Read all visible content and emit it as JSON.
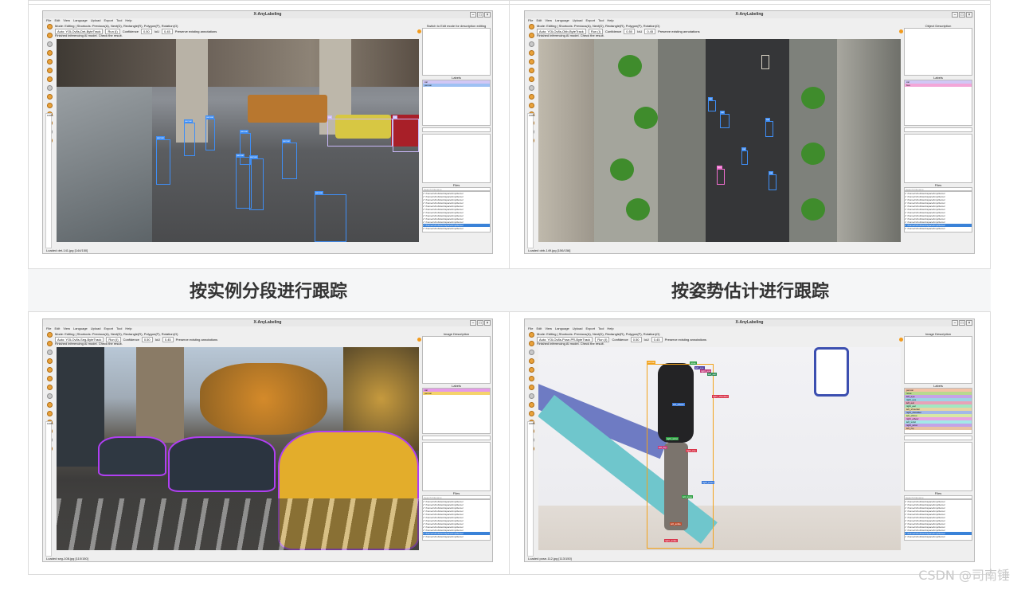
{
  "captions": {
    "segmentation": "按实例分段进行跟踪",
    "pose": "按姿势估计进行跟踪"
  },
  "watermark": "CSDN @司南锤",
  "app": {
    "window_title": "X-AnyLabeling",
    "menu": [
      "File",
      "Edit",
      "View",
      "Language",
      "Upload",
      "Export",
      "Tool",
      "Help"
    ],
    "mode_text": "Mode: Editing | Shortcuts: Previous(A), Next(D), Rectangle(R), Polygon(P), Rotation(O)",
    "status_msg": "Finished inferencing AI model. Check the result.",
    "run_label": "Run (I)",
    "confidence_label": "Confidence",
    "confidence_value": "0.50",
    "iou_label": "IoU",
    "iou_value": "0.45",
    "preserve_label": "Preserve existing annotations",
    "labels_title": "Labels",
    "files_title": "Files",
    "search_placeholder": "Search Filename",
    "file_row": "/home/cvhub/workspace/tmp/demo/"
  },
  "panels": [
    {
      "model": "Auto: YOLOv8s-Det-ByteTrack",
      "run_value": "Run (I)",
      "description_title": "Switch to Edit mode for description editing",
      "status": "Loaded det-141.jpg [144/150]",
      "labels": [
        "car",
        "person"
      ],
      "label_colors": [
        "#d1c7f5",
        "#9ec1f3"
      ]
    },
    {
      "model": "Auto: YOLOv8s-Obb-ByteTrack",
      "run_value": "Run (I)",
      "description_title": "Object Description",
      "status": "Loaded obb-149.jpg [156/156]",
      "labels": [
        "car",
        "bus"
      ],
      "label_colors": [
        "#d1c7f5",
        "#f3a6d8"
      ]
    },
    {
      "model": "Auto: YOLOv8s-Seg-ByteTrack",
      "run_value": "Run (I)",
      "description_title": "Image Description",
      "status": "Loaded seg-108.jpg [110/150]",
      "labels": [
        "car",
        "person"
      ],
      "label_colors": [
        "#e59be8",
        "#f5d36b"
      ]
    },
    {
      "model": "Auto: YOLOv8s-Pose-PR-ByteTrack",
      "run_value": "Run (I)",
      "description_title": "Image Description",
      "status": "Loaded pose-112.jpg [113/150]",
      "labels": [
        "person",
        "nose",
        "left_eye",
        "right_eye",
        "left_ear",
        "right_ear",
        "left_shoulder",
        "right_shoulder",
        "left_elbow",
        "right_elbow",
        "left_wrist",
        "right_wrist",
        "left_hip"
      ],
      "label_colors": [
        "#f3c2a6",
        "#b8d98f",
        "#c6a3e8",
        "#9fd3e6",
        "#e8a3b8",
        "#a3e8c2",
        "#e8d5a3",
        "#a3b8e8",
        "#d8e8a3",
        "#e8a3e0",
        "#a3e8e8",
        "#c2a3e8",
        "#e8c2a3"
      ]
    }
  ],
  "pose_keypoints": [
    "nose",
    "left_eye",
    "right_eye",
    "left_ear",
    "right_shoulder",
    "left_elbow",
    "right_wrist",
    "left_hip",
    "right_hip",
    "left_knee",
    "right_knee",
    "left_ankle",
    "right_ankle"
  ],
  "colors": {
    "person_box": "#3f8ef5",
    "car_box": "#c9b8f7",
    "bus_box": "#f26fd1",
    "seg_outline": "#b03ff2",
    "pose_box": "#f2a21b",
    "file_selected": "#3a82d8"
  }
}
